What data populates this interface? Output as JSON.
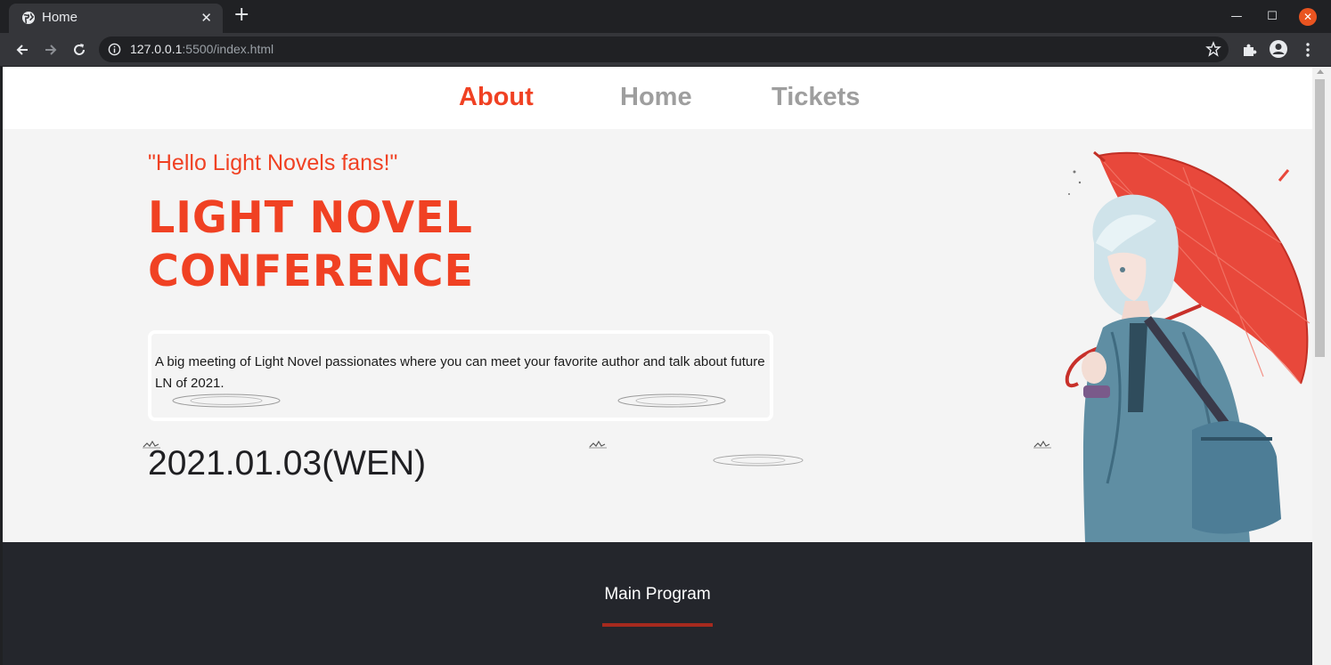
{
  "browser": {
    "tab_title": "Home",
    "url_host": "127.0.0.1",
    "url_rest": ":5500/index.html"
  },
  "colors": {
    "accent": "#f04123",
    "nav_inactive": "#9e9e9e",
    "dark_section": "#24262c",
    "underline": "#a62a1e"
  },
  "nav": {
    "items": [
      {
        "label": "About",
        "active": true
      },
      {
        "label": "Home",
        "active": false
      },
      {
        "label": "Tickets",
        "active": false
      }
    ]
  },
  "hero": {
    "greeting": "\"Hello Light Novels fans!\"",
    "title_line1": "LIGHT NOVEL",
    "title_line2": "CONFERENCE",
    "description": "A big meeting of Light Novel passionates where you can meet your favorite author and talk about future LN of 2021.",
    "date": "2021.01.03(WEN)"
  },
  "program": {
    "title": "Main Program"
  },
  "icons": {
    "favicon": "globe-icon",
    "back": "arrow-left-icon",
    "forward": "arrow-right-icon",
    "reload": "reload-icon",
    "site_info": "info-icon",
    "bookmark": "star-icon",
    "extensions": "puzzle-icon",
    "profile": "account-icon",
    "menu": "kebab-menu-icon"
  }
}
